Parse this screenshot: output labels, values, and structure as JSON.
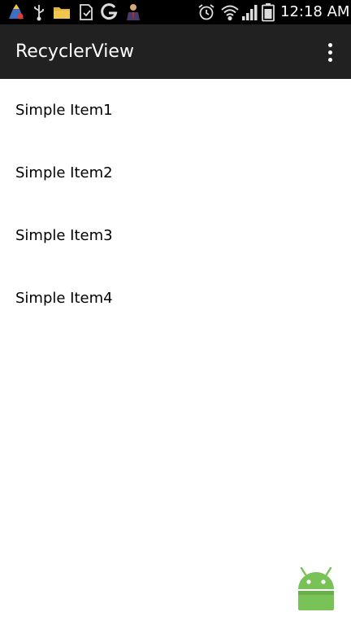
{
  "status_bar": {
    "time": "12:18 AM",
    "notification_icons": [
      "cleaner-icon",
      "usb-icon",
      "folder-icon",
      "download-icon",
      "google-icon",
      "person-icon"
    ],
    "system_icons": [
      "alarm-icon",
      "wifi-icon",
      "signal-icon",
      "battery-icon"
    ]
  },
  "app_bar": {
    "title": "RecyclerView",
    "overflow_icon": "more-vert-icon",
    "background_color": "#212121"
  },
  "list": {
    "items": [
      {
        "label": "Simple Item1"
      },
      {
        "label": "Simple Item2"
      },
      {
        "label": "Simple Item3"
      },
      {
        "label": "Simple Item4"
      }
    ]
  },
  "overlay": {
    "icon": "android-logo-icon",
    "color": "#78c257"
  }
}
